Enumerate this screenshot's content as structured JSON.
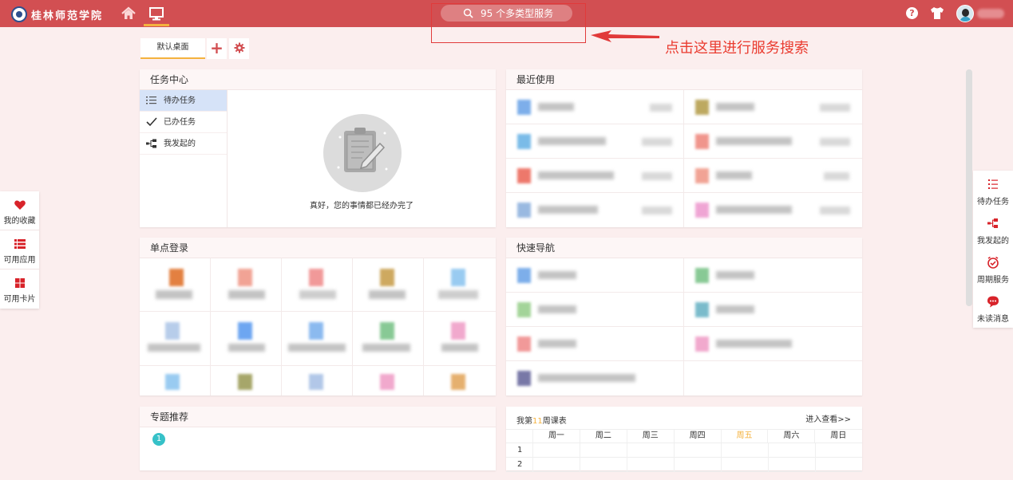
{
  "header": {
    "school_name": "桂林师范学院",
    "search_text": "95 个多类型服务",
    "help_glyph": "?"
  },
  "annotation": {
    "text": "点击这里进行服务搜索",
    "color": "#ea3b2f"
  },
  "tabs": {
    "default_label": "默认桌面",
    "add_glyph": "+"
  },
  "left_float": {
    "items": [
      {
        "label": "我的收藏",
        "icon": "heart-icon"
      },
      {
        "label": "可用应用",
        "icon": "list-icon"
      },
      {
        "label": "可用卡片",
        "icon": "grid-icon"
      }
    ]
  },
  "right_float": {
    "items": [
      {
        "label": "待办任务",
        "icon": "todo-list-icon"
      },
      {
        "label": "我发起的",
        "icon": "branch-icon"
      },
      {
        "label": "周期服务",
        "icon": "clock-check-icon"
      },
      {
        "label": "未读消息",
        "icon": "chat-bubble-icon"
      }
    ]
  },
  "task_center": {
    "title": "任务中心",
    "items": [
      {
        "label": "待办任务",
        "icon": "todo-list-icon"
      },
      {
        "label": "已办任务",
        "icon": "check-icon"
      },
      {
        "label": "我发起的",
        "icon": "branch-icon"
      }
    ],
    "empty_text": "真好，您的事情都已经办完了"
  },
  "recent_use": {
    "title": "最近使用"
  },
  "single_sign_on": {
    "title": "单点登录"
  },
  "quick_nav": {
    "title": "快速导航"
  },
  "topic": {
    "title": "专题推荐",
    "badge": "1"
  },
  "timetable": {
    "prefix": "我第",
    "week": "11",
    "suffix": "周课表",
    "more": "进入查看>>",
    "days": [
      "周一",
      "周二",
      "周三",
      "周四",
      "周五",
      "周六",
      "周日"
    ],
    "today_index": 4,
    "rows": [
      "1",
      "2"
    ]
  },
  "colors": {
    "brand": "#d24f52",
    "accent": "#f4b23e",
    "page_bg": "#fbeeee",
    "active_item": "#d6e3f8"
  }
}
